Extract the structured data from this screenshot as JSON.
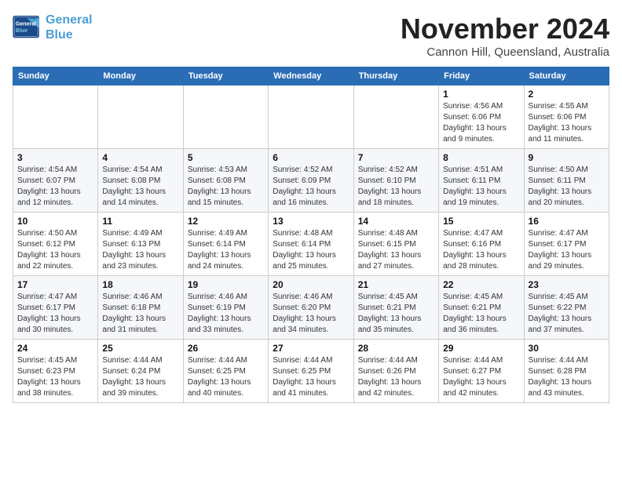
{
  "header": {
    "logo_line1": "General",
    "logo_line2": "Blue",
    "month": "November 2024",
    "location": "Cannon Hill, Queensland, Australia"
  },
  "days_of_week": [
    "Sunday",
    "Monday",
    "Tuesday",
    "Wednesday",
    "Thursday",
    "Friday",
    "Saturday"
  ],
  "weeks": [
    [
      {
        "day": "",
        "info": ""
      },
      {
        "day": "",
        "info": ""
      },
      {
        "day": "",
        "info": ""
      },
      {
        "day": "",
        "info": ""
      },
      {
        "day": "",
        "info": ""
      },
      {
        "day": "1",
        "info": "Sunrise: 4:56 AM\nSunset: 6:06 PM\nDaylight: 13 hours and 9 minutes."
      },
      {
        "day": "2",
        "info": "Sunrise: 4:55 AM\nSunset: 6:06 PM\nDaylight: 13 hours and 11 minutes."
      }
    ],
    [
      {
        "day": "3",
        "info": "Sunrise: 4:54 AM\nSunset: 6:07 PM\nDaylight: 13 hours and 12 minutes."
      },
      {
        "day": "4",
        "info": "Sunrise: 4:54 AM\nSunset: 6:08 PM\nDaylight: 13 hours and 14 minutes."
      },
      {
        "day": "5",
        "info": "Sunrise: 4:53 AM\nSunset: 6:08 PM\nDaylight: 13 hours and 15 minutes."
      },
      {
        "day": "6",
        "info": "Sunrise: 4:52 AM\nSunset: 6:09 PM\nDaylight: 13 hours and 16 minutes."
      },
      {
        "day": "7",
        "info": "Sunrise: 4:52 AM\nSunset: 6:10 PM\nDaylight: 13 hours and 18 minutes."
      },
      {
        "day": "8",
        "info": "Sunrise: 4:51 AM\nSunset: 6:11 PM\nDaylight: 13 hours and 19 minutes."
      },
      {
        "day": "9",
        "info": "Sunrise: 4:50 AM\nSunset: 6:11 PM\nDaylight: 13 hours and 20 minutes."
      }
    ],
    [
      {
        "day": "10",
        "info": "Sunrise: 4:50 AM\nSunset: 6:12 PM\nDaylight: 13 hours and 22 minutes."
      },
      {
        "day": "11",
        "info": "Sunrise: 4:49 AM\nSunset: 6:13 PM\nDaylight: 13 hours and 23 minutes."
      },
      {
        "day": "12",
        "info": "Sunrise: 4:49 AM\nSunset: 6:14 PM\nDaylight: 13 hours and 24 minutes."
      },
      {
        "day": "13",
        "info": "Sunrise: 4:48 AM\nSunset: 6:14 PM\nDaylight: 13 hours and 25 minutes."
      },
      {
        "day": "14",
        "info": "Sunrise: 4:48 AM\nSunset: 6:15 PM\nDaylight: 13 hours and 27 minutes."
      },
      {
        "day": "15",
        "info": "Sunrise: 4:47 AM\nSunset: 6:16 PM\nDaylight: 13 hours and 28 minutes."
      },
      {
        "day": "16",
        "info": "Sunrise: 4:47 AM\nSunset: 6:17 PM\nDaylight: 13 hours and 29 minutes."
      }
    ],
    [
      {
        "day": "17",
        "info": "Sunrise: 4:47 AM\nSunset: 6:17 PM\nDaylight: 13 hours and 30 minutes."
      },
      {
        "day": "18",
        "info": "Sunrise: 4:46 AM\nSunset: 6:18 PM\nDaylight: 13 hours and 31 minutes."
      },
      {
        "day": "19",
        "info": "Sunrise: 4:46 AM\nSunset: 6:19 PM\nDaylight: 13 hours and 33 minutes."
      },
      {
        "day": "20",
        "info": "Sunrise: 4:46 AM\nSunset: 6:20 PM\nDaylight: 13 hours and 34 minutes."
      },
      {
        "day": "21",
        "info": "Sunrise: 4:45 AM\nSunset: 6:21 PM\nDaylight: 13 hours and 35 minutes."
      },
      {
        "day": "22",
        "info": "Sunrise: 4:45 AM\nSunset: 6:21 PM\nDaylight: 13 hours and 36 minutes."
      },
      {
        "day": "23",
        "info": "Sunrise: 4:45 AM\nSunset: 6:22 PM\nDaylight: 13 hours and 37 minutes."
      }
    ],
    [
      {
        "day": "24",
        "info": "Sunrise: 4:45 AM\nSunset: 6:23 PM\nDaylight: 13 hours and 38 minutes."
      },
      {
        "day": "25",
        "info": "Sunrise: 4:44 AM\nSunset: 6:24 PM\nDaylight: 13 hours and 39 minutes."
      },
      {
        "day": "26",
        "info": "Sunrise: 4:44 AM\nSunset: 6:25 PM\nDaylight: 13 hours and 40 minutes."
      },
      {
        "day": "27",
        "info": "Sunrise: 4:44 AM\nSunset: 6:25 PM\nDaylight: 13 hours and 41 minutes."
      },
      {
        "day": "28",
        "info": "Sunrise: 4:44 AM\nSunset: 6:26 PM\nDaylight: 13 hours and 42 minutes."
      },
      {
        "day": "29",
        "info": "Sunrise: 4:44 AM\nSunset: 6:27 PM\nDaylight: 13 hours and 42 minutes."
      },
      {
        "day": "30",
        "info": "Sunrise: 4:44 AM\nSunset: 6:28 PM\nDaylight: 13 hours and 43 minutes."
      }
    ]
  ]
}
